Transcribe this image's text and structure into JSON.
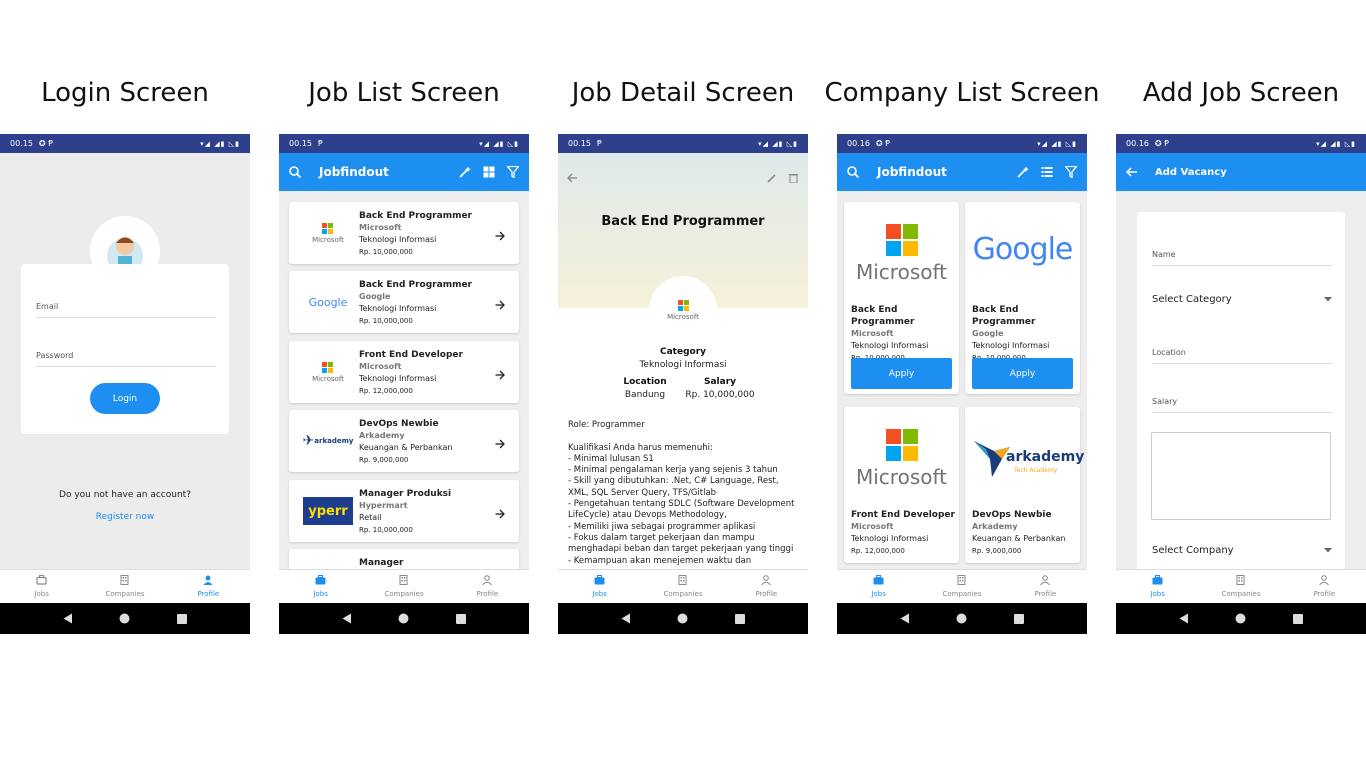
{
  "titles": {
    "login": "Login Screen",
    "joblist": "Job List Screen",
    "jobdetail": "Job Detail Screen",
    "companylist": "Company List Screen",
    "addjob": "Add Job Screen"
  },
  "status": {
    "time1": "00.15",
    "time2": "00.16"
  },
  "nav": {
    "jobs": "Jobs",
    "companies": "Companies",
    "profile": "Profile"
  },
  "colors": {
    "primary": "#1c8ff0",
    "statusbar": "#2e3f8c"
  },
  "login": {
    "email_placeholder": "Email",
    "password_placeholder": "Password",
    "login_label": "Login",
    "no_account": "Do you not have an account?",
    "register_label": "Register now"
  },
  "joblist": {
    "app_title": "Jobfindout",
    "items": [
      {
        "name": "Back End Programmer",
        "company": "Microsoft",
        "category": "Teknologi Informasi",
        "salary": "Rp. 10,000,000",
        "logo": "Microsoft"
      },
      {
        "name": "Back End Programmer",
        "company": "Google",
        "category": "Teknologi Informasi",
        "salary": "Rp. 10,000,000",
        "logo": "Google"
      },
      {
        "name": "Front End Developer",
        "company": "Microsoft",
        "category": "Teknologi Informasi",
        "salary": "Rp. 12,000,000",
        "logo": "Microsoft"
      },
      {
        "name": "DevOps Newbie",
        "company": "Arkademy",
        "category": "Keuangan & Perbankan",
        "salary": "Rp. 9,000,000",
        "logo": "arkademy"
      },
      {
        "name": "Manager Produksi",
        "company": "Hypermart",
        "category": "Retail",
        "salary": "Rp. 10,000,000",
        "logo": "yperr"
      },
      {
        "name": "Manager",
        "company": "",
        "category": "",
        "salary": "",
        "logo": ""
      }
    ]
  },
  "jobdetail": {
    "job_title": "Back End Programmer",
    "company_logo": "Microsoft",
    "category_label": "Category",
    "category_value": "Teknologi Informasi",
    "location_label": "Location",
    "location_value": "Bandung",
    "salary_label": "Salary",
    "salary_value": "Rp. 10,000,000",
    "description": "Role: Programmer\n\nKualifikasi Anda harus memenuhi:\n- Minimal lulusan S1\n- Minimal pengalaman kerja yang sejenis 3 tahun\n- Skill yang dibutuhkan: .Net, C# Language, Rest, XML, SQL Server Query, TFS/Gitlab\n- Pengetahuan tentang SDLC (Software Development LifeCycle) atau Devops Methodology,\n- Memiliki jiwa sebagai programmer aplikasi\n- Fokus dalam target pekerjaan dan mampu menghadapi beban dan target pekerjaan yang tinggi\n- Kemampuan akan menejemen waktu dan"
  },
  "companylist": {
    "app_title": "Jobfindout",
    "apply_label": "Apply",
    "cards": [
      {
        "name": "Back End Programmer",
        "company": "Microsoft",
        "category": "Teknologi Informasi",
        "salary": "Rp. 10,000,000",
        "logo": "Microsoft"
      },
      {
        "name": "Back End Programmer",
        "company": "Google",
        "category": "Teknologi Informasi",
        "salary": "Rp. 10,000,000",
        "logo": "Google"
      },
      {
        "name": "Front End Developer",
        "company": "Microsoft",
        "category": "Teknologi Informasi",
        "salary": "Rp. 12,000,000",
        "logo": "Microsoft"
      },
      {
        "name": "DevOps Newbie",
        "company": "Arkademy",
        "category": "Keuangan & Perbankan",
        "salary": "Rp. 9,000,000",
        "logo": "arkademy",
        "logo_sub": "Tech Academy"
      }
    ]
  },
  "addjob": {
    "app_title": "Add Vacancy",
    "name_placeholder": "Name",
    "category_select": "Select Category",
    "location_placeholder": "Location",
    "salary_placeholder": "Salary",
    "company_select": "Select Company"
  }
}
